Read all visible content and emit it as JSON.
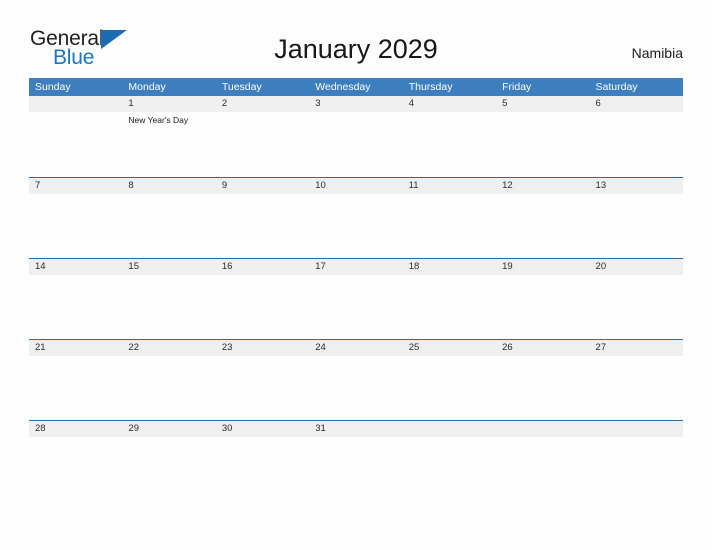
{
  "brand": {
    "name_part1": "General",
    "name_part2": "Blue",
    "flag_icon": "triangle-flag-icon",
    "colors": {
      "text_dark": "#231f20",
      "blue": "#1b77c4",
      "flag": "#1b6cb0"
    }
  },
  "header": {
    "title": "January 2029",
    "country": "Namibia"
  },
  "calendar": {
    "colors": {
      "weekday_header_bg": "#3d7ebe",
      "weekday_header_text": "#ffffff",
      "date_band_bg": "#efefef",
      "row_border": "#2e6da4",
      "page_bg": "#fdfdfd"
    },
    "weekdays": [
      "Sunday",
      "Monday",
      "Tuesday",
      "Wednesday",
      "Thursday",
      "Friday",
      "Saturday"
    ],
    "weeks": [
      {
        "days": [
          {
            "date": "",
            "event": ""
          },
          {
            "date": "1",
            "event": "New Year's Day"
          },
          {
            "date": "2",
            "event": ""
          },
          {
            "date": "3",
            "event": ""
          },
          {
            "date": "4",
            "event": ""
          },
          {
            "date": "5",
            "event": ""
          },
          {
            "date": "6",
            "event": ""
          }
        ]
      },
      {
        "days": [
          {
            "date": "7",
            "event": ""
          },
          {
            "date": "8",
            "event": ""
          },
          {
            "date": "9",
            "event": ""
          },
          {
            "date": "10",
            "event": ""
          },
          {
            "date": "11",
            "event": ""
          },
          {
            "date": "12",
            "event": ""
          },
          {
            "date": "13",
            "event": ""
          }
        ]
      },
      {
        "days": [
          {
            "date": "14",
            "event": ""
          },
          {
            "date": "15",
            "event": ""
          },
          {
            "date": "16",
            "event": ""
          },
          {
            "date": "17",
            "event": ""
          },
          {
            "date": "18",
            "event": ""
          },
          {
            "date": "19",
            "event": ""
          },
          {
            "date": "20",
            "event": ""
          }
        ]
      },
      {
        "days": [
          {
            "date": "21",
            "event": ""
          },
          {
            "date": "22",
            "event": ""
          },
          {
            "date": "23",
            "event": ""
          },
          {
            "date": "24",
            "event": ""
          },
          {
            "date": "25",
            "event": ""
          },
          {
            "date": "26",
            "event": ""
          },
          {
            "date": "27",
            "event": ""
          }
        ]
      },
      {
        "days": [
          {
            "date": "28",
            "event": ""
          },
          {
            "date": "29",
            "event": ""
          },
          {
            "date": "30",
            "event": ""
          },
          {
            "date": "31",
            "event": ""
          },
          {
            "date": "",
            "event": ""
          },
          {
            "date": "",
            "event": ""
          },
          {
            "date": "",
            "event": ""
          }
        ]
      }
    ]
  }
}
